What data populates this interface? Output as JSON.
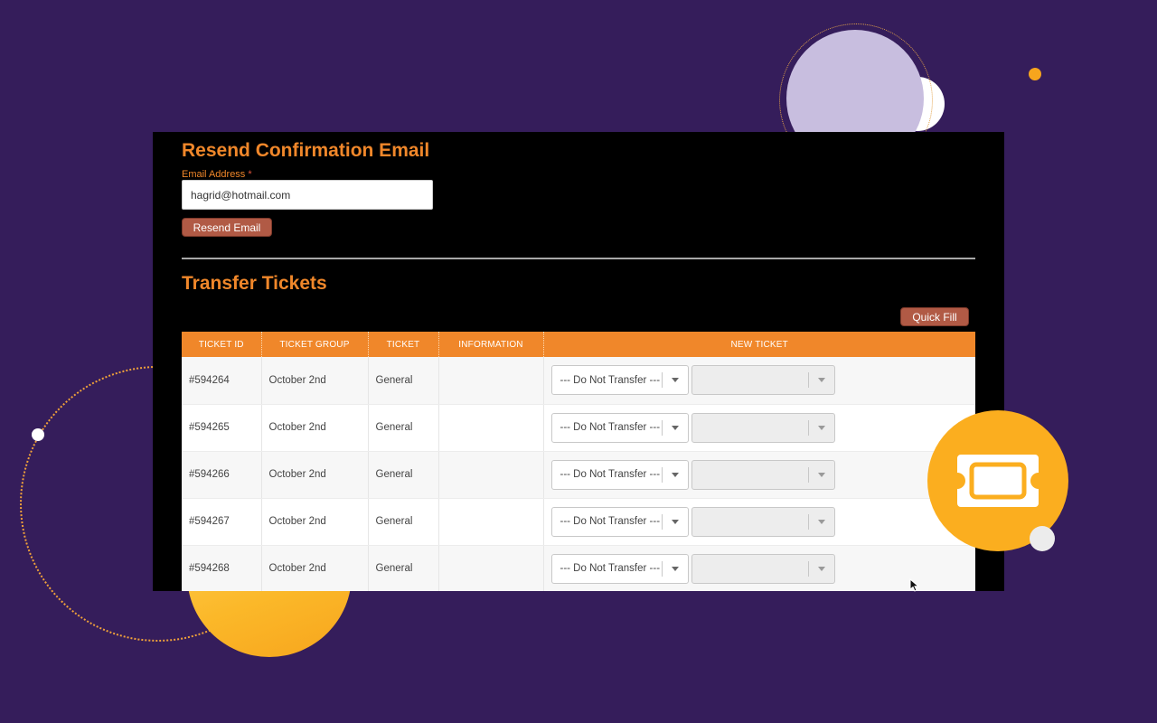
{
  "resend": {
    "title": "Resend Confirmation Email",
    "email_label": "Email Address",
    "required_mark": "*",
    "email_value": "hagrid@hotmail.com",
    "button_label": "Resend Email"
  },
  "transfer": {
    "title": "Transfer Tickets",
    "quick_fill_label": "Quick Fill",
    "columns": [
      "TICKET ID",
      "TICKET GROUP",
      "TICKET",
      "INFORMATION",
      "NEW TICKET"
    ],
    "rows": [
      {
        "id": "#594264",
        "group": "October 2nd",
        "ticket": "General",
        "information": "",
        "new_ticket": "--- Do Not Transfer ---",
        "second_select": ""
      },
      {
        "id": "#594265",
        "group": "October 2nd",
        "ticket": "General",
        "information": "",
        "new_ticket": "--- Do Not Transfer ---",
        "second_select": ""
      },
      {
        "id": "#594266",
        "group": "October 2nd",
        "ticket": "General",
        "information": "",
        "new_ticket": "--- Do Not Transfer ---",
        "second_select": ""
      },
      {
        "id": "#594267",
        "group": "October 2nd",
        "ticket": "General",
        "information": "",
        "new_ticket": "--- Do Not Transfer ---",
        "second_select": ""
      },
      {
        "id": "#594268",
        "group": "October 2nd",
        "ticket": "General",
        "information": "",
        "new_ticket": "--- Do Not Transfer ---",
        "second_select": ""
      }
    ]
  },
  "colors": {
    "background": "#351d5b",
    "accent_orange": "#f0872a",
    "button": "#b15a45",
    "badge_yellow": "#fbae1f",
    "lavender": "#c8bedf"
  },
  "icons": {
    "badge": "ticket-icon",
    "pointer": "mouse-cursor-icon"
  }
}
